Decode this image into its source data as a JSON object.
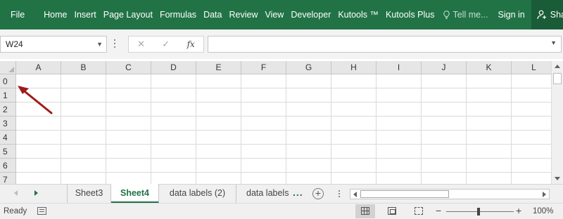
{
  "ribbon": {
    "tabs": [
      "Insert",
      "Page Layout",
      "Formulas",
      "Data",
      "Review",
      "View",
      "Developer",
      "Kutools ™",
      "Kutools Plus"
    ],
    "file_label": "File",
    "home_label": "Home",
    "tell_me": "Tell me...",
    "sign_in": "Sign in",
    "share": "Share",
    "bg_color": "#217346"
  },
  "formula_bar": {
    "name_box": "W24",
    "cancel_icon": "✕",
    "enter_icon": "✓",
    "fx_label": "fx",
    "formula": ""
  },
  "grid": {
    "columns": [
      "A",
      "B",
      "C",
      "D",
      "E",
      "F",
      "G",
      "H",
      "I",
      "J",
      "K",
      "L"
    ],
    "rows": [
      "0",
      "1",
      "2",
      "3",
      "4",
      "5",
      "6",
      "7"
    ],
    "annotation_arrow_color": "#9e1b1b"
  },
  "sheet_tabs": {
    "tabs": [
      "Sheet3",
      "Sheet4",
      "data labels (2)",
      "data labels"
    ],
    "active": "Sheet4",
    "more": "...",
    "add": "+"
  },
  "status_bar": {
    "ready": "Ready",
    "zoom_minus": "−",
    "zoom_plus": "+",
    "zoom": "100%"
  }
}
